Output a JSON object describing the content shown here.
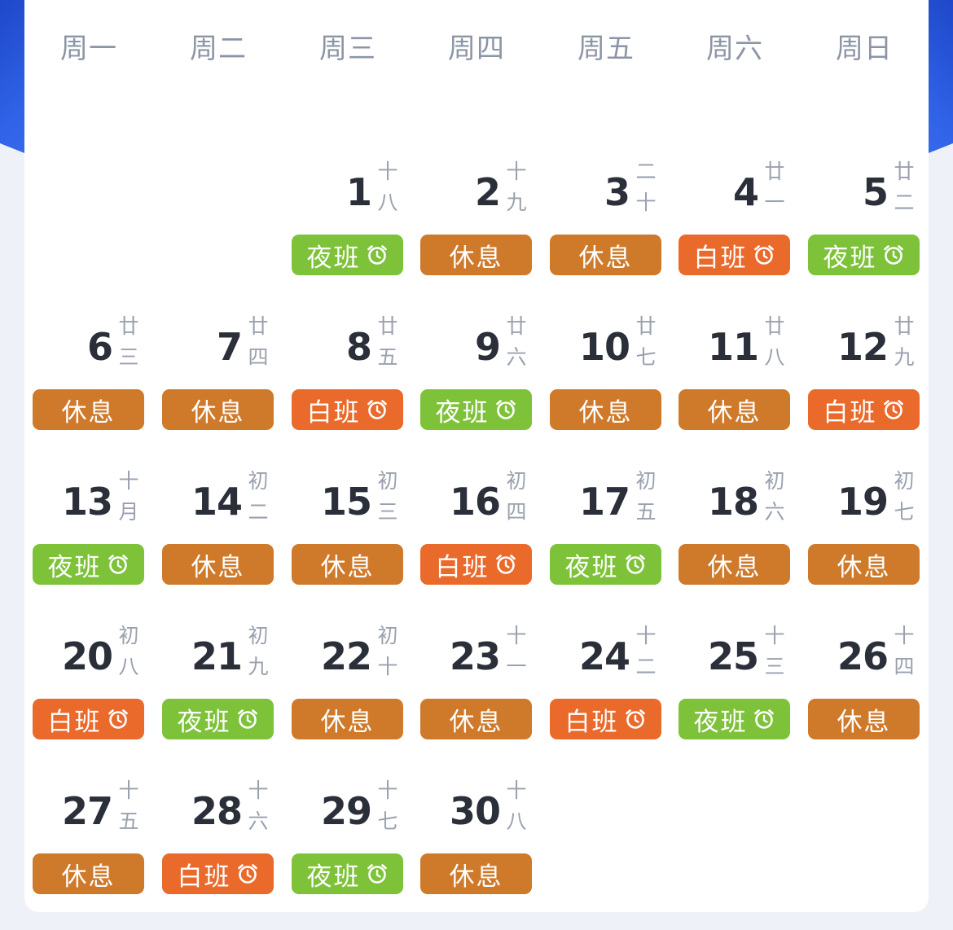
{
  "weekdays": [
    "周一",
    "周二",
    "周三",
    "周四",
    "周五",
    "周六",
    "周日"
  ],
  "colors": {
    "rest": "#cf7a2b",
    "day_shift": "#ea6a2c",
    "night_shift": "#7ec23a"
  },
  "days": [
    {
      "num": "1",
      "lunar1": "十",
      "lunar2": "八",
      "shift": "夜班",
      "type": "night",
      "alarm": true
    },
    {
      "num": "2",
      "lunar1": "十",
      "lunar2": "九",
      "shift": "休息",
      "type": "rest",
      "alarm": false
    },
    {
      "num": "3",
      "lunar1": "二",
      "lunar2": "十",
      "shift": "休息",
      "type": "rest",
      "alarm": false
    },
    {
      "num": "4",
      "lunar1": "廿",
      "lunar2": "一",
      "shift": "白班",
      "type": "day-shift",
      "alarm": true
    },
    {
      "num": "5",
      "lunar1": "廿",
      "lunar2": "二",
      "shift": "夜班",
      "type": "night",
      "alarm": true
    },
    {
      "num": "6",
      "lunar1": "廿",
      "lunar2": "三",
      "shift": "休息",
      "type": "rest",
      "alarm": false
    },
    {
      "num": "7",
      "lunar1": "廿",
      "lunar2": "四",
      "shift": "休息",
      "type": "rest",
      "alarm": false
    },
    {
      "num": "8",
      "lunar1": "廿",
      "lunar2": "五",
      "shift": "白班",
      "type": "day-shift",
      "alarm": true
    },
    {
      "num": "9",
      "lunar1": "廿",
      "lunar2": "六",
      "shift": "夜班",
      "type": "night",
      "alarm": true
    },
    {
      "num": "10",
      "lunar1": "廿",
      "lunar2": "七",
      "shift": "休息",
      "type": "rest",
      "alarm": false
    },
    {
      "num": "11",
      "lunar1": "廿",
      "lunar2": "八",
      "shift": "休息",
      "type": "rest",
      "alarm": false
    },
    {
      "num": "12",
      "lunar1": "廿",
      "lunar2": "九",
      "shift": "白班",
      "type": "day-shift",
      "alarm": true
    },
    {
      "num": "13",
      "lunar1": "十",
      "lunar2": "月",
      "shift": "夜班",
      "type": "night",
      "alarm": true
    },
    {
      "num": "14",
      "lunar1": "初",
      "lunar2": "二",
      "shift": "休息",
      "type": "rest",
      "alarm": false
    },
    {
      "num": "15",
      "lunar1": "初",
      "lunar2": "三",
      "shift": "休息",
      "type": "rest",
      "alarm": false
    },
    {
      "num": "16",
      "lunar1": "初",
      "lunar2": "四",
      "shift": "白班",
      "type": "day-shift",
      "alarm": true
    },
    {
      "num": "17",
      "lunar1": "初",
      "lunar2": "五",
      "shift": "夜班",
      "type": "night",
      "alarm": true
    },
    {
      "num": "18",
      "lunar1": "初",
      "lunar2": "六",
      "shift": "休息",
      "type": "rest",
      "alarm": false
    },
    {
      "num": "19",
      "lunar1": "初",
      "lunar2": "七",
      "shift": "休息",
      "type": "rest",
      "alarm": false
    },
    {
      "num": "20",
      "lunar1": "初",
      "lunar2": "八",
      "shift": "白班",
      "type": "day-shift",
      "alarm": true
    },
    {
      "num": "21",
      "lunar1": "初",
      "lunar2": "九",
      "shift": "夜班",
      "type": "night",
      "alarm": true
    },
    {
      "num": "22",
      "lunar1": "初",
      "lunar2": "十",
      "shift": "休息",
      "type": "rest",
      "alarm": false
    },
    {
      "num": "23",
      "lunar1": "十",
      "lunar2": "一",
      "shift": "休息",
      "type": "rest",
      "alarm": false
    },
    {
      "num": "24",
      "lunar1": "十",
      "lunar2": "二",
      "shift": "白班",
      "type": "day-shift",
      "alarm": true
    },
    {
      "num": "25",
      "lunar1": "十",
      "lunar2": "三",
      "shift": "夜班",
      "type": "night",
      "alarm": true
    },
    {
      "num": "26",
      "lunar1": "十",
      "lunar2": "四",
      "shift": "休息",
      "type": "rest",
      "alarm": false
    },
    {
      "num": "27",
      "lunar1": "十",
      "lunar2": "五",
      "shift": "休息",
      "type": "rest",
      "alarm": false
    },
    {
      "num": "28",
      "lunar1": "十",
      "lunar2": "六",
      "shift": "白班",
      "type": "day-shift",
      "alarm": true
    },
    {
      "num": "29",
      "lunar1": "十",
      "lunar2": "七",
      "shift": "夜班",
      "type": "night",
      "alarm": true
    },
    {
      "num": "30",
      "lunar1": "十",
      "lunar2": "八",
      "shift": "休息",
      "type": "rest",
      "alarm": false
    }
  ]
}
